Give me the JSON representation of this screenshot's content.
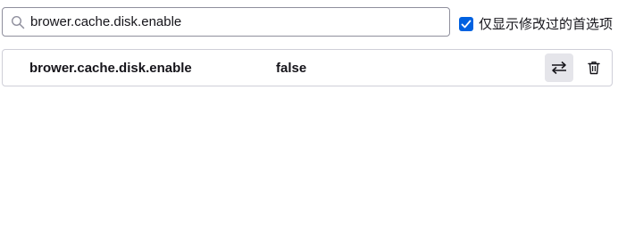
{
  "search": {
    "value": "brower.cache.disk.enable",
    "icon": "search-icon"
  },
  "filter": {
    "label": "仅显示修改过的首选项",
    "checked": true,
    "accent_color": "#0061e0"
  },
  "preferences": [
    {
      "name": "brower.cache.disk.enable",
      "value": "false",
      "toggle_icon": "toggle-arrows-icon",
      "delete_icon": "trash-icon"
    }
  ]
}
